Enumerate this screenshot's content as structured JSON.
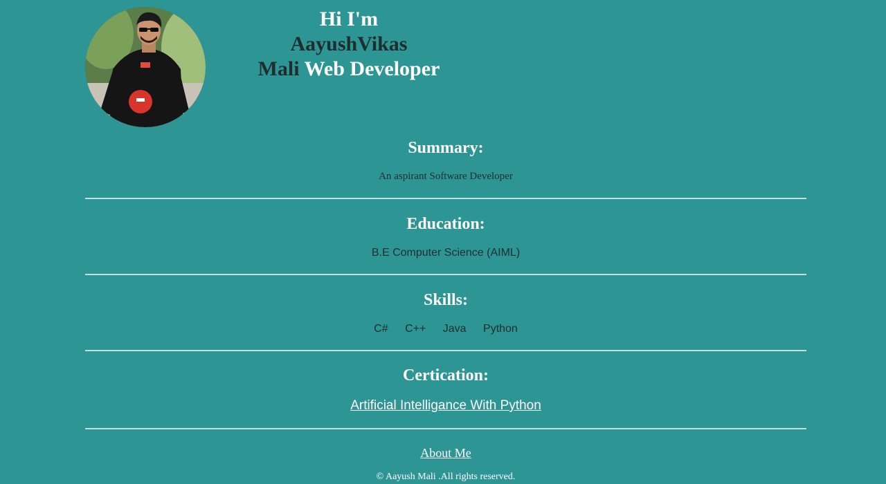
{
  "header": {
    "greeting": "Hi I'm",
    "name": "AayushVikas",
    "surname": "Mali",
    "role": "Web Developer"
  },
  "summary": {
    "heading": "Summary:",
    "text": "An aspirant Software Developer"
  },
  "education": {
    "heading": "Education:",
    "text": "B.E Computer Science (AIML)"
  },
  "skills": {
    "heading": "Skills:",
    "items": [
      "C#",
      "C++",
      "Java",
      "Python"
    ]
  },
  "certification": {
    "heading": "Certication:",
    "link_text": "Artificial Intelligance With Python"
  },
  "about": {
    "link_text": "About Me"
  },
  "footer": {
    "text": "© Aayush Mali .All rights reserved."
  },
  "colors": {
    "background": "#2e9595",
    "heading": "#ffffff",
    "body_text": "#1e2e2e",
    "rule": "#c9dede"
  }
}
